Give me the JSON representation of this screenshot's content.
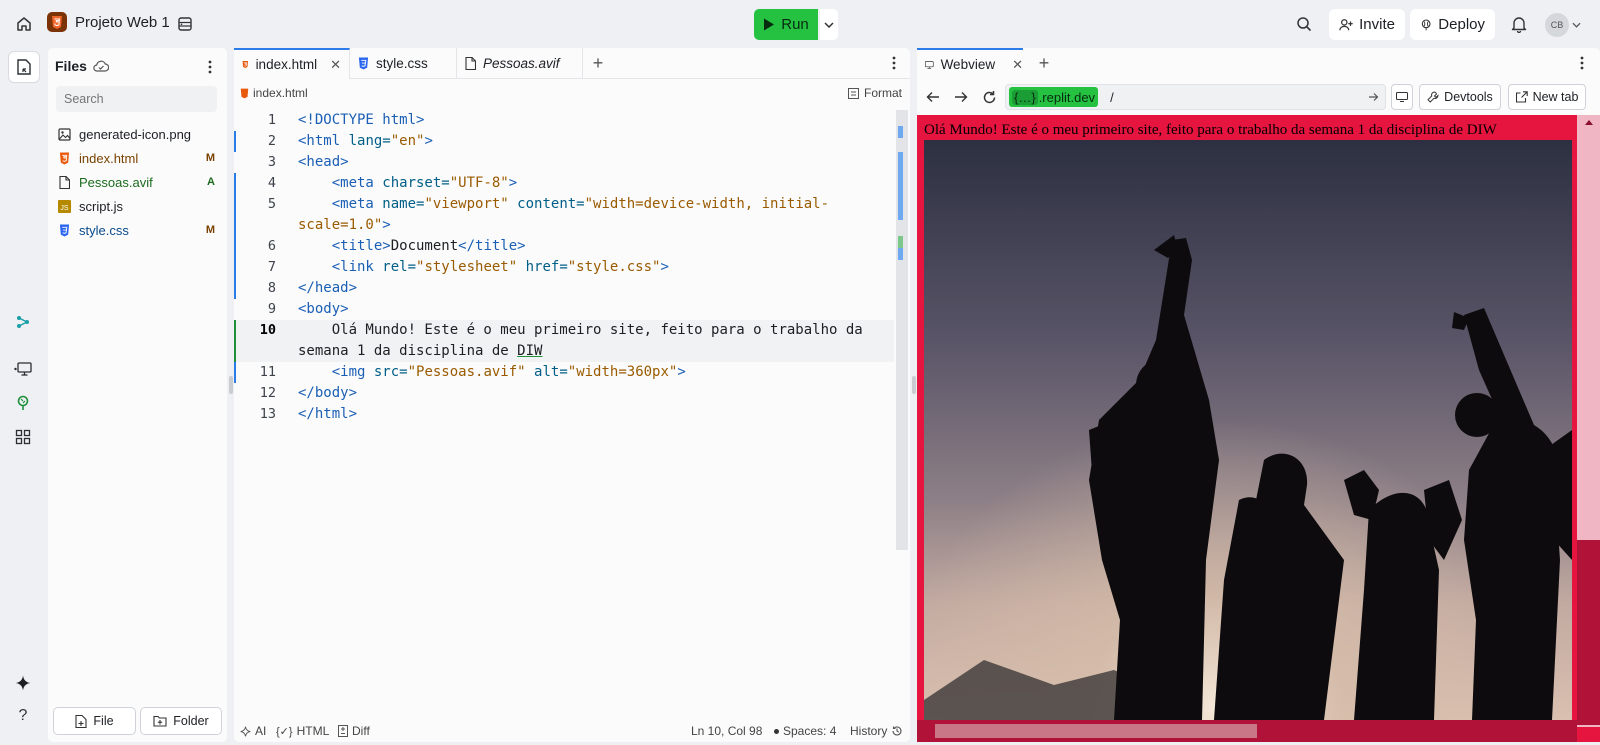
{
  "project": {
    "name": "Projeto Web 1"
  },
  "top": {
    "run_label": "Run",
    "invite_label": "Invite",
    "deploy_label": "Deploy",
    "avatar_initials": "CB"
  },
  "colors": {
    "accent": "#2b7ce9",
    "run": "#25c242",
    "page_bg": "#e6153f"
  },
  "files": {
    "title": "Files",
    "search_placeholder": "Search",
    "items": [
      {
        "name": "generated-icon.png",
        "icon": "image-icon",
        "badge": ""
      },
      {
        "name": "index.html",
        "icon": "html5-icon",
        "badge": "M"
      },
      {
        "name": "Pessoas.avif",
        "icon": "file-icon",
        "badge": "A"
      },
      {
        "name": "script.js",
        "icon": "js-icon",
        "badge": ""
      },
      {
        "name": "style.css",
        "icon": "css3-icon",
        "badge": "M"
      }
    ],
    "new_file_label": "File",
    "new_folder_label": "Folder"
  },
  "editor": {
    "tabs": [
      {
        "label": "index.html",
        "icon": "html5-icon"
      },
      {
        "label": "style.css",
        "icon": "css3-icon"
      },
      {
        "label": "Pessoas.avif",
        "icon": "file-icon"
      }
    ],
    "breadcrumb": "index.html",
    "format_label": "Format",
    "line_numbers": [
      "1",
      "2",
      "3",
      "4",
      "5",
      "6",
      "7",
      "8",
      "9",
      "10",
      "11",
      "12",
      "13"
    ],
    "code": {
      "l1": "<!DOCTYPE html>",
      "l2_tag": "<html",
      "l2_attr": " lang=",
      "l2_val": "\"en\"",
      "l2_end": ">",
      "l3": "<head>",
      "l4_tag": "    <meta",
      "l4_attr": " charset=",
      "l4_val": "\"UTF-8\"",
      "l4_end": ">",
      "l5_tag": "    <meta",
      "l5_attr1": " name=",
      "l5_val1": "\"viewport\"",
      "l5_attr2": " content=",
      "l5_val2": "\"width=device-width, initial-scale=1.0\"",
      "l5_end": ">",
      "l6_tag": "    <title>",
      "l6_text": "Document",
      "l6_end": "</title>",
      "l7_tag": "    <link",
      "l7_attr1": " rel=",
      "l7_val1": "\"stylesheet\"",
      "l7_attr2": " href=",
      "l7_val2": "\"style.css\"",
      "l7_end": ">",
      "l8": "</head>",
      "l9": "<body>",
      "l10_text": "    Olá Mundo! Este é o meu primeiro site, feito para o trabalho da semana 1 da disciplina de ",
      "l10_ud": "DIW",
      "l11_tag": "    <img",
      "l11_attr1": " src=",
      "l11_val1": "\"Pessoas.avif\"",
      "l11_attr2": " alt=",
      "l11_val2": "\"width=360px\"",
      "l11_end": ">",
      "l12": "</body>",
      "l13": "</html>"
    },
    "status": {
      "ai": "AI",
      "lang": "HTML",
      "diff": "Diff",
      "position": "Ln 10, Col 98",
      "spaces": "Spaces: 4",
      "history": "History"
    }
  },
  "webview": {
    "tab_label": "Webview",
    "url_host_badge": "{…}",
    "url_host": ".replit.dev",
    "url_path": "/",
    "devtools_label": "Devtools",
    "newtab_label": "New tab",
    "page_text": "Olá Mundo! Este é o meu primeiro site, feito para o trabalho da semana 1 da disciplina de DIW"
  }
}
